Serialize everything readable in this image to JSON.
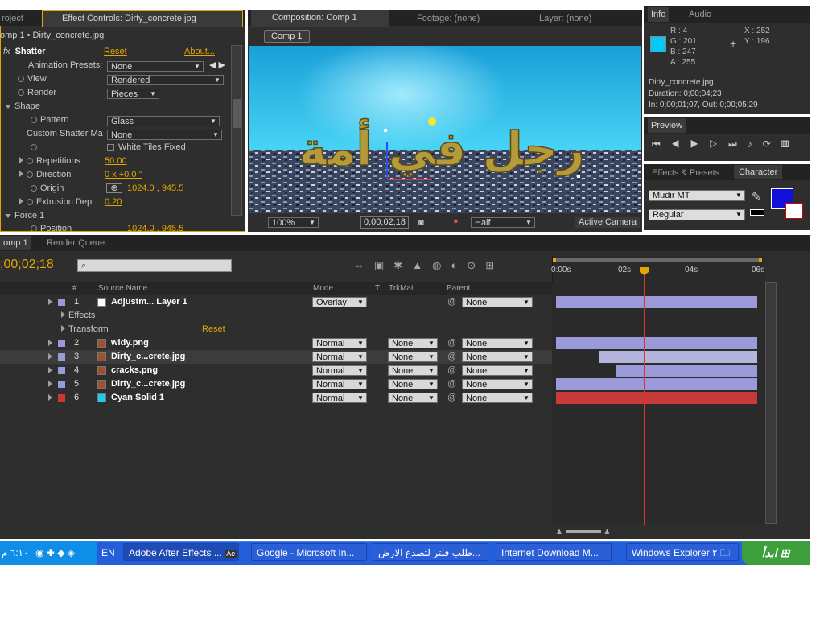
{
  "project_tab": {
    "label": "roject"
  },
  "effect_tab": {
    "label": "Effect Controls: Dirty_concrete.jpg"
  },
  "effect_panel": {
    "breadcrumb": "omp 1 • Dirty_concrete.jpg",
    "effect_name": "Shatter",
    "reset": "Reset",
    "about": "About...",
    "anim_presets_label": "Animation Presets:",
    "anim_presets_value": "None",
    "view_label": "View",
    "view_value": "Rendered",
    "render_label": "Render",
    "render_value": "Pieces",
    "shape_label": "Shape",
    "pattern_label": "Pattern",
    "pattern_value": "Glass",
    "custom_label": "Custom Shatter Ma",
    "custom_value": "None",
    "white_tiles_label": "White Tiles Fixed",
    "repetitions_label": "Repetitions",
    "repetitions_value": "50.00",
    "direction_label": "Direction",
    "direction_value": "0 x +0.0 °",
    "origin_label": "Origin",
    "origin_value": "1024.0 , 945.5",
    "extrusion_label": "Extrusion Dept",
    "extrusion_value": "0.20",
    "force_label": "Force 1",
    "position_label": "Position",
    "position_value": "1024.0 , 945.5"
  },
  "comp_tabs": {
    "composition": "Composition: Comp 1",
    "footage": "Footage: (none)",
    "layer": "Layer: (none)",
    "comp_button": "Comp 1"
  },
  "viewer": {
    "arabic_text": "رجل في أمة",
    "zoom": "100%",
    "timecode": "0;00;02;18",
    "resolution": "Half",
    "camera": "Active Camera"
  },
  "info": {
    "tab_info": "Info",
    "tab_audio": "Audio",
    "r": "R : 4",
    "g": "G : 201",
    "b": "B : 247",
    "a": "A : 255",
    "x": "X : 252",
    "y": "Y : 196",
    "swatch_color": "#04c9f7",
    "file": "Dirty_concrete.jpg",
    "duration": "Duration: 0;00;04;23",
    "inout": "In: 0;00;01;07, Out: 0;00;05;29"
  },
  "preview": {
    "tab": "Preview"
  },
  "character": {
    "tab_effects": "Effects & Presets",
    "tab_character": "Character",
    "font": "Mudir MT",
    "style": "Regular",
    "fill_color": "#1010d8"
  },
  "timeline": {
    "tab_comp": "omp 1",
    "tab_render": "Render Queue",
    "timecode": ";00;02;18",
    "col_num": "#",
    "col_source": "Source Name",
    "col_mode": "Mode",
    "col_t": "T",
    "col_trkmat": "TrkMat",
    "col_parent": "Parent",
    "ruler": [
      "0:00s",
      "02s",
      "04s",
      "06s"
    ],
    "layers": [
      {
        "num": "1",
        "name": "Adjustm... Layer 1",
        "color": "#9a9ad8",
        "swatch": "#ffffff",
        "mode": "Overlay",
        "trkmat": "",
        "parent": "None"
      },
      {
        "num": "2",
        "name": "wldy.png",
        "color": "#9a9ad8",
        "swatch": "",
        "mode": "Normal",
        "trkmat": "None",
        "parent": "None"
      },
      {
        "num": "3",
        "name": "Dirty_c...crete.jpg",
        "color": "#9a9ad8",
        "swatch": "",
        "mode": "Normal",
        "trkmat": "None",
        "parent": "None"
      },
      {
        "num": "4",
        "name": "cracks.png",
        "color": "#9a9ad8",
        "swatch": "",
        "mode": "Normal",
        "trkmat": "None",
        "parent": "None"
      },
      {
        "num": "5",
        "name": "Dirty_c...crete.jpg",
        "color": "#9a9ad8",
        "swatch": "",
        "mode": "Normal",
        "trkmat": "None",
        "parent": "None"
      },
      {
        "num": "6",
        "name": "Cyan Solid 1",
        "color": "#c83a3a",
        "swatch": "#19d0e8",
        "mode": "Normal",
        "trkmat": "None",
        "parent": "None"
      }
    ],
    "effects_label": "Effects",
    "transform_label": "Transform",
    "transform_reset": "Reset"
  },
  "taskbar": {
    "clock": "٦:١٠ م",
    "lang": "EN",
    "tasks": [
      "Adobe After Effects ...",
      "Google - Microsoft In...",
      "طلب فلتر لتصدع الارض...",
      "Internet Download M...",
      "Windows Explorer ٢"
    ],
    "start": "ابدأ"
  }
}
